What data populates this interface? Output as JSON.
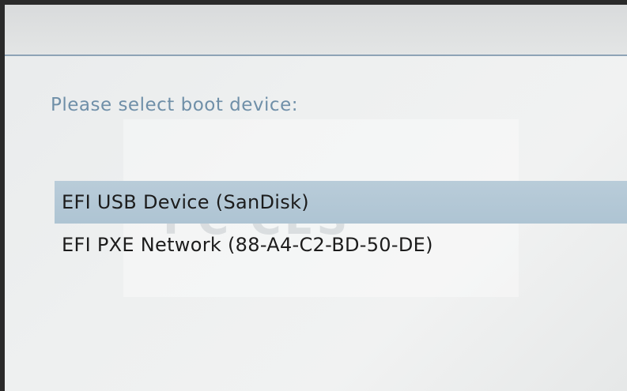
{
  "boot_menu": {
    "prompt": "Please select boot device:",
    "devices": [
      {
        "label": "EFI USB Device (SanDisk)",
        "selected": true
      },
      {
        "label": "EFI PXE Network (88-A4-C2-BD-50-DE)",
        "selected": false
      }
    ],
    "watermark_text": "PC     CES"
  },
  "colors": {
    "prompt_text": "#6f8fa8",
    "selection_highlight": "#b4c8d6",
    "rule_line": "#8ea3b6",
    "item_text": "#1c1c1c"
  }
}
